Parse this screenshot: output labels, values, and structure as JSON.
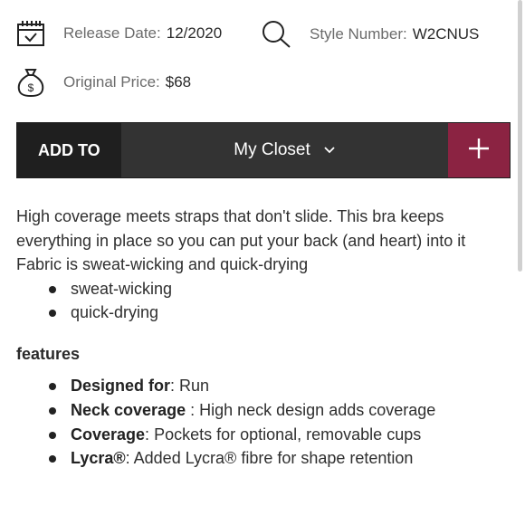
{
  "info": {
    "release_label": "Release Date:",
    "release_value": "12/2020",
    "style_label": "Style Number:",
    "style_value": "W2CNUS",
    "price_label": "Original Price:",
    "price_value": "$68",
    "icons": [
      "calendar-icon",
      "search-icon",
      "money-bag-icon"
    ]
  },
  "closet": {
    "add_to_label": "ADD TO",
    "selected": "My Closet",
    "plus": "+"
  },
  "description": {
    "text": "High coverage meets straps that don't slide. This bra keeps everything in place so you can put your back (and heart) into it Fabric is sweat-wicking and quick-drying",
    "bullets": [
      "sweat-wicking",
      "quick-drying"
    ]
  },
  "features": {
    "title": "features",
    "items": [
      {
        "term": "Designed for",
        "sep": ": ",
        "text": "Run"
      },
      {
        "term": "Neck coverage",
        "sep": " : ",
        "text": "High neck design adds coverage"
      },
      {
        "term": "Coverage",
        "sep": ": ",
        "text": "Pockets for optional, removable cups"
      },
      {
        "term": "Lycra®",
        "sep": ": ",
        "text": "Added Lycra® fibre for shape retention"
      }
    ]
  },
  "colors": {
    "accent": "#8b2342",
    "dark": "#1f1f1f",
    "bar": "#333333"
  }
}
